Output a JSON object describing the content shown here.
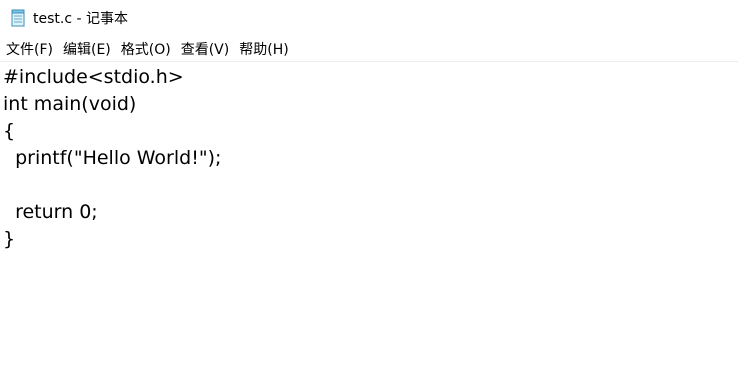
{
  "window": {
    "title": "test.c - 记事本",
    "icon": "notepad-icon"
  },
  "menu": {
    "items": [
      {
        "label": "文件(F)"
      },
      {
        "label": "编辑(E)"
      },
      {
        "label": "格式(O)"
      },
      {
        "label": "查看(V)"
      },
      {
        "label": "帮助(H)"
      }
    ]
  },
  "editor": {
    "lines": [
      "#include<stdio.h>",
      "int main(void)",
      "{",
      "  printf(\"Hello World!\");",
      "",
      "  return 0;",
      "}"
    ]
  },
  "colors": {
    "background": "#ffffff",
    "text": "#000000"
  }
}
